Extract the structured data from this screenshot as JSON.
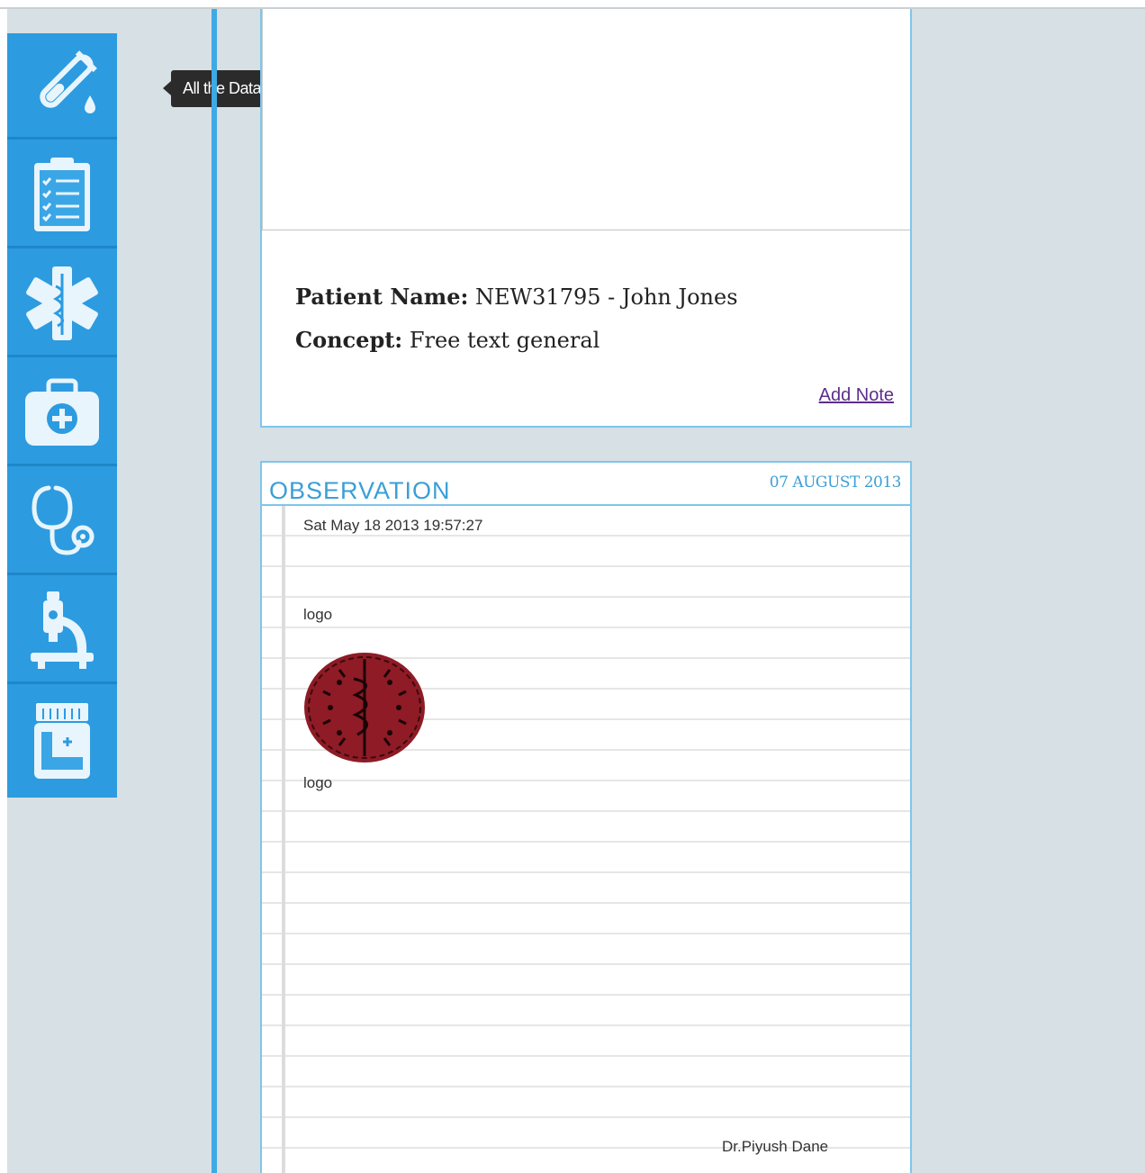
{
  "tooltip": {
    "text": "All the Data"
  },
  "sidebar": {
    "items": [
      {
        "icon": "test-tube-icon"
      },
      {
        "icon": "clipboard-checklist-icon"
      },
      {
        "icon": "star-of-life-icon"
      },
      {
        "icon": "first-aid-kit-icon"
      },
      {
        "icon": "stethoscope-icon"
      },
      {
        "icon": "microscope-icon"
      },
      {
        "icon": "medicine-jar-icon"
      }
    ]
  },
  "patient": {
    "name_label": "Patient Name:",
    "name_value": "NEW31795 - John Jones",
    "concept_label": "Concept:",
    "concept_value": "Free text general",
    "add_note": "Add Note"
  },
  "observation": {
    "title": "OBSERVATION",
    "date": "07 AUGUST 2013",
    "timestamp": "Sat May 18 2013 19:57:27",
    "logo_label_1": "logo",
    "logo_label_2": "logo",
    "doctor": "Dr.Piyush Dane"
  },
  "colors": {
    "sidebar": "#2d9be0",
    "accent": "#3a9fd6",
    "link": "#5b2e8c"
  }
}
